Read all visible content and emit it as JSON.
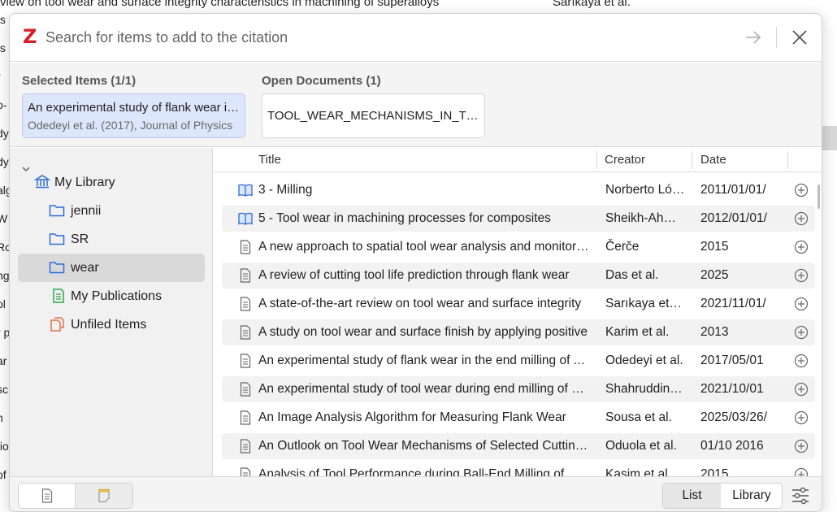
{
  "background": {
    "top_text_left": "view on tool wear and surface integrity characteristics in machining of superalloys",
    "top_text_right": "Sarıkaya et al.",
    "left_fragments": [
      "ts",
      "ts",
      "r",
      "o-",
      "dy",
      "dy",
      "alg",
      "W",
      "Ro",
      "ng",
      "ol",
      "r p",
      "ar",
      "sc",
      "n",
      "tio",
      "of"
    ]
  },
  "search": {
    "placeholder": "Search for items to add to the citation",
    "logo": "Z"
  },
  "selected": {
    "label": "Selected Items (1/1)",
    "item_title": "An experimental study of flank wear in the end milling",
    "item_meta": "Odedeyi et al. (2017), Journal of Physics"
  },
  "open_docs": {
    "label": "Open Documents (1)",
    "doc_name": "TOOL_WEAR_MECHANISMS_IN_TOOLS"
  },
  "tree": {
    "library": "My Library",
    "collections": [
      "jennii",
      "SR",
      "wear"
    ],
    "publications": "My Publications",
    "unfiled": "Unfiled Items"
  },
  "columns": {
    "title": "Title",
    "creator": "Creator",
    "date": "Date"
  },
  "items": [
    {
      "type": "book",
      "title": "3 - Milling",
      "creator": "Norberto López de Lacalle",
      "date": "2011/01/01/"
    },
    {
      "type": "book",
      "title": "5 - Tool wear in machining processes for composites",
      "creator": "Sheikh-Ahmad",
      "date": "2012/01/01/"
    },
    {
      "type": "doc",
      "title": "A new approach to spatial tool wear analysis and monitoring",
      "creator": "Čerče",
      "date": "2015"
    },
    {
      "type": "doc",
      "title": "A review of cutting tool life prediction through flank wear",
      "creator": "Das et al.",
      "date": "2025"
    },
    {
      "type": "doc",
      "title": "A state-of-the-art review on tool wear and surface integrity",
      "creator": "Sarıkaya et al.",
      "date": "2021/11/01/"
    },
    {
      "type": "doc",
      "title": "A study on tool wear and surface finish by applying positive",
      "creator": "Karim et al.",
      "date": "2013"
    },
    {
      "type": "doc",
      "title": "An experimental study of flank wear in the end milling of AISI",
      "creator": "Odedeyi et al.",
      "date": "2017/05/01"
    },
    {
      "type": "doc",
      "title": "An experimental study of tool wear during end milling of steel",
      "creator": "Shahruddin et al.",
      "date": "2021/10/01"
    },
    {
      "type": "doc",
      "title": "An Image Analysis Algorithm for Measuring Flank Wear",
      "creator": "Sousa et al.",
      "date": "2025/03/26/"
    },
    {
      "type": "doc",
      "title": "An Outlook on Tool Wear Mechanisms of Selected Cutting Tools",
      "creator": "Oduola et al.",
      "date": "01/10 2016"
    },
    {
      "type": "doc",
      "title": "Analysis of Tool Performance during Ball-End Milling of",
      "creator": "Kasim et al.",
      "date": "2015"
    }
  ],
  "footer": {
    "list_label": "List",
    "library_label": "Library"
  }
}
